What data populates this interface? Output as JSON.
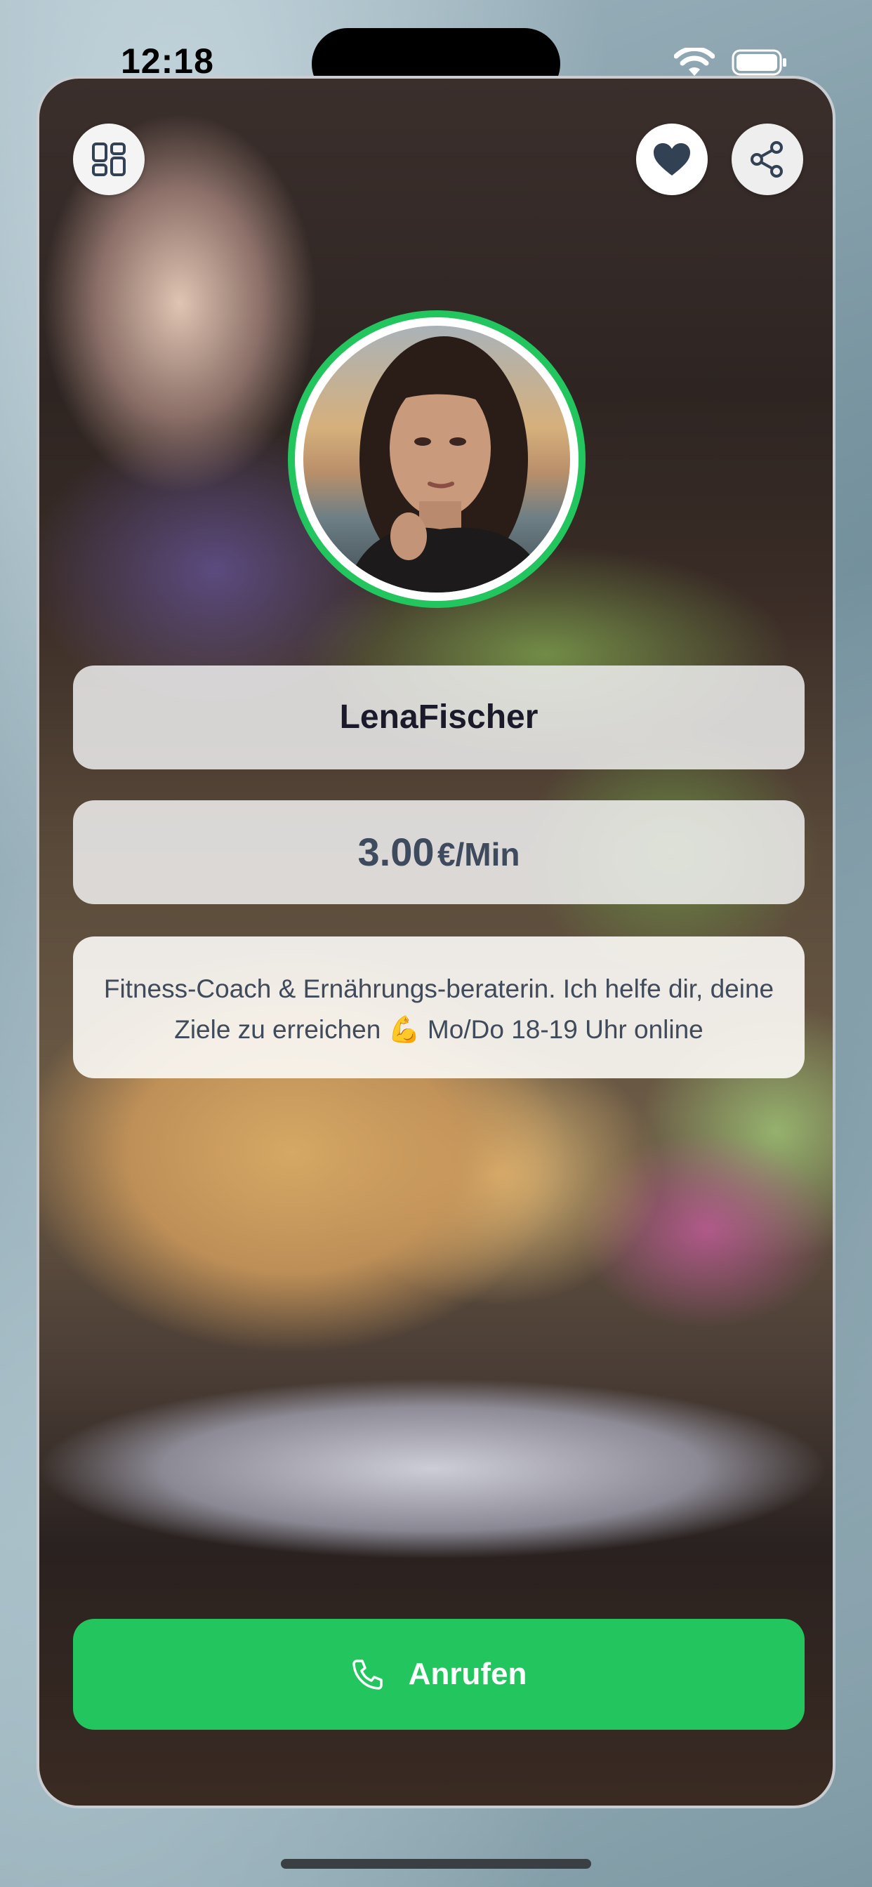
{
  "status_bar": {
    "time": "12:18",
    "icons": [
      "wifi-icon",
      "battery-icon"
    ]
  },
  "header": {
    "menu_icon": "grid-icon",
    "favorite_icon": "heart-icon",
    "share_icon": "share-icon"
  },
  "profile": {
    "name": "LenaFischer",
    "price_value": "3.00",
    "price_unit": "€/Min",
    "bio": "Fitness-Coach & Ernährungs-beraterin. Ich helfe dir, deine Ziele zu erreichen 💪 Mo/Do 18-19 Uhr online",
    "status_color": "#22c55e"
  },
  "actions": {
    "call_label": "Anrufen",
    "call_icon": "phone-icon",
    "call_color": "#22c55e"
  }
}
